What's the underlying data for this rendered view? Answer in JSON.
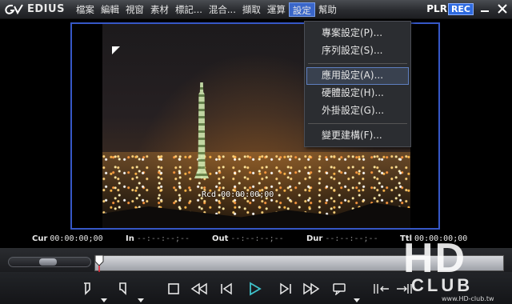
{
  "app": {
    "name": "EDIUS",
    "mode_plr": "PLR",
    "mode_rec": "REC"
  },
  "menubar": {
    "items": [
      {
        "label": "檔案"
      },
      {
        "label": "編輯"
      },
      {
        "label": "視窗"
      },
      {
        "label": "素材"
      },
      {
        "label": "標記..."
      },
      {
        "label": "混合..."
      },
      {
        "label": "擷取"
      },
      {
        "label": "運算"
      },
      {
        "label": "設定",
        "active": true
      },
      {
        "label": "幫助"
      }
    ]
  },
  "settings_menu": {
    "items": [
      {
        "label": "專案設定(P)..."
      },
      {
        "label": "序列設定(S)..."
      },
      {
        "label": "應用設定(A)...",
        "highlighted": true
      },
      {
        "label": "硬體設定(H)..."
      },
      {
        "label": "外掛設定(G)..."
      },
      {
        "label": "變更建構(F)..."
      }
    ]
  },
  "viewer": {
    "overlay_timecode": "Rcd 00:00:00;00"
  },
  "timecodes": {
    "cur_label": "Cur",
    "cur_value": "00:00:00;00",
    "in_label": "In",
    "in_value": "--:--:--;--",
    "out_label": "Out",
    "out_value": "--:--:--;--",
    "dur_label": "Dur",
    "dur_value": "--:--:--;--",
    "ttl_label": "Ttl",
    "ttl_value": "00:00:00;00"
  },
  "watermark": {
    "text_big": "HD",
    "text_club": "CLUB",
    "site": "www.HD-club.tw"
  },
  "colors": {
    "accent": "#3a66c9",
    "frame_border": "#3657c7",
    "rec_badge": "#2f6be0",
    "play_icon": "#3fc1c9"
  }
}
